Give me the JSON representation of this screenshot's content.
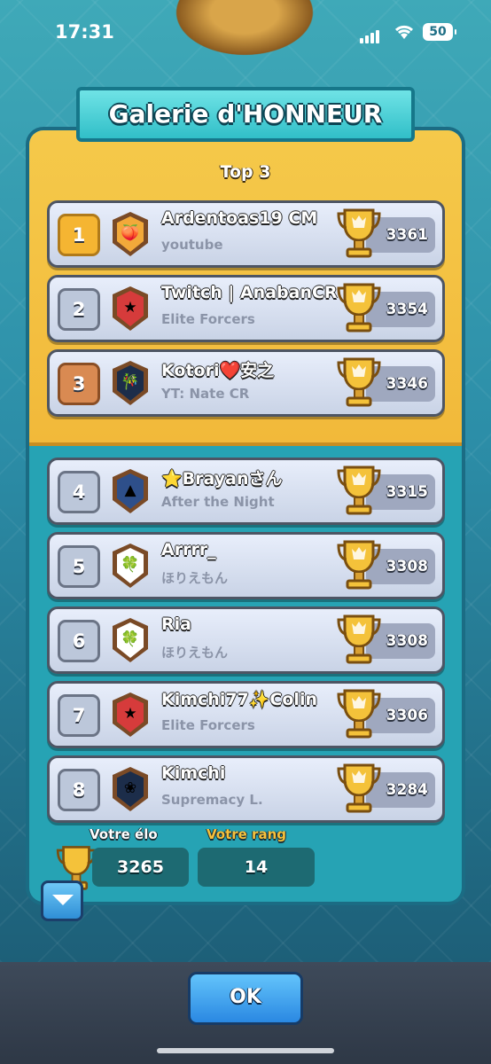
{
  "status": {
    "time": "17:31",
    "battery": "50"
  },
  "title": "Galerie d'HONNEUR",
  "section_label": "Top 3",
  "players": [
    {
      "rank": "1",
      "name": "Ardentoas19 CM",
      "clan": "youtube",
      "score": "3361",
      "badge": "🍑",
      "badge_color": "#f2a93a"
    },
    {
      "rank": "2",
      "name": "Twitch | AnabanCR",
      "clan": "Elite Forcers",
      "score": "3354",
      "badge": "★",
      "badge_color": "#d63b3b"
    },
    {
      "rank": "3",
      "name": "Kotori❤️安之",
      "clan": "YT: Nate CR",
      "score": "3346",
      "badge": "🎋",
      "badge_color": "#1c2d4a"
    },
    {
      "rank": "4",
      "name": "⭐Brayanさん",
      "clan": "After the Night",
      "score": "3315",
      "badge": "▲",
      "badge_color": "#2e4f8a"
    },
    {
      "rank": "5",
      "name": "Arrrr_",
      "clan": "ほりえもん",
      "score": "3308",
      "badge": "🍀",
      "badge_color": "#ffffff"
    },
    {
      "rank": "6",
      "name": "Ria",
      "clan": "ほりえもん",
      "score": "3308",
      "badge": "🍀",
      "badge_color": "#ffffff"
    },
    {
      "rank": "7",
      "name": "Kimchi77✨Colin",
      "clan": "Elite Forcers",
      "score": "3306",
      "badge": "★",
      "badge_color": "#d63b3b"
    },
    {
      "rank": "8",
      "name": "Kimchi",
      "clan": "Supremacy L.",
      "score": "3284",
      "badge": "❀",
      "badge_color": "#1c2d4a"
    }
  ],
  "your_elo": {
    "label": "Votre élo",
    "value": "3265"
  },
  "your_rank": {
    "label": "Votre rang",
    "value": "14"
  },
  "ok_label": "OK",
  "colors": {
    "gold_panel": "#f2b93a",
    "teal_panel": "#26a3b4",
    "label_gold": "#f6c13c"
  }
}
